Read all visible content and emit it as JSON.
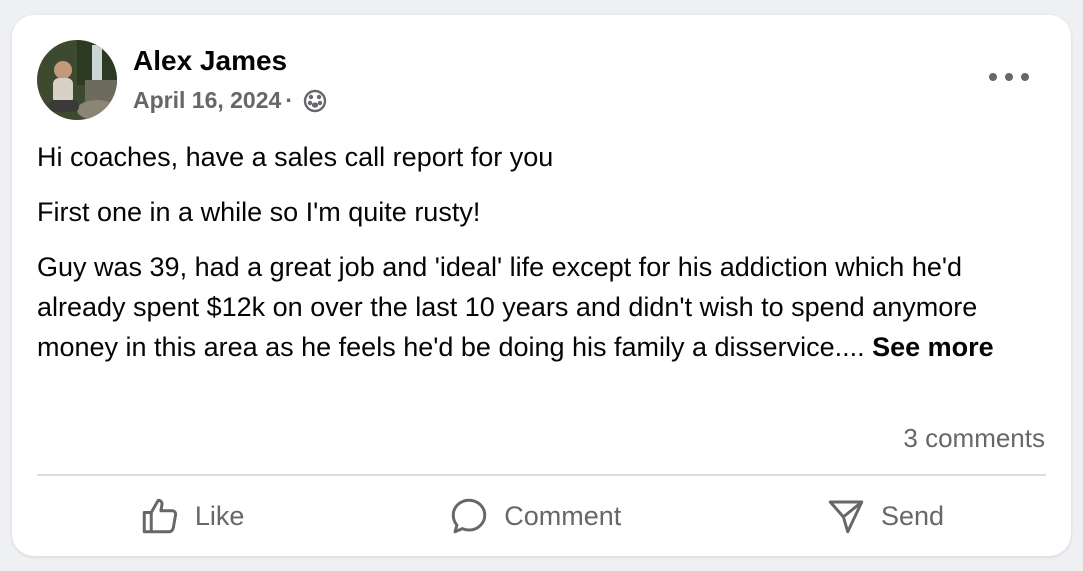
{
  "post": {
    "author": "Alex James",
    "date": "April 16, 2024",
    "separator": "·",
    "audience_icon": "globe-icon",
    "paragraphs": [
      "Hi coaches, have a sales call report for you",
      "First one in a while so I'm quite rusty!",
      "Guy was 39, had a great job and 'ideal' life except for his addiction which he'd already spent $12k on over the last 10 years and didn't wish to spend anymore money in this area as he feels he'd be doing his family a disservice...."
    ],
    "see_more": "See more",
    "comments_count": "3 comments"
  },
  "actions": {
    "like": "Like",
    "comment": "Comment",
    "send": "Send"
  },
  "colors": {
    "text": "#050505",
    "secondary": "#65676b",
    "divider": "#dadde1"
  }
}
